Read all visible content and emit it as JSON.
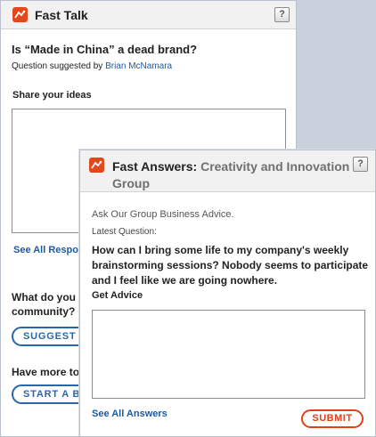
{
  "fast_talk": {
    "title": "Fast Talk",
    "help": "?",
    "question": "Is “Made in China” a dead brand?",
    "suggested_prefix": "Question suggested by",
    "suggested_author": "Brian McNamara",
    "share_label": "Share your ideas",
    "see_all_link": "See All Respo",
    "community_line1": "What do you",
    "community_line2": "community?",
    "suggest_button": "SUGGEST A",
    "more_label": "Have more to",
    "start_button": "START A BLO"
  },
  "fast_answers": {
    "title_strong": "Fast Answers:",
    "title_muted": "Creativity and Innovation",
    "title_muted_line2": "Group",
    "help": "?",
    "intro": "Ask Our Group Business Advice.",
    "latest_label": "Latest Question:",
    "question_line1": "How can I bring some life to my company's weekly",
    "question_line2": "brainstorming sessions? Nobody seems to participate",
    "question_line3": "and I feel like we are going nowhere.",
    "get_advice_label": "Get Advice",
    "see_all_link": "See All Answers",
    "submit_button": "SUBMIT"
  },
  "colors": {
    "brand_orange": "#e1491d",
    "link_blue": "#1a5ba6",
    "button_blue": "#2a66ad",
    "submit_red": "#e0411a"
  }
}
